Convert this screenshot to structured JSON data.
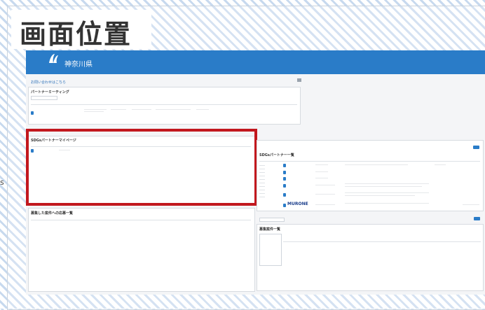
{
  "overlay": {
    "label": "画面位置"
  },
  "header": {
    "title": "神奈川県"
  },
  "contact": {
    "link_text": "お問い合わせはこちら"
  },
  "partner_meeting": {
    "title": "パートナーミーティング",
    "filter_placeholder": "",
    "columns": [
      "",
      "",
      "",
      "",
      "",
      "",
      ""
    ]
  },
  "sdgs_mypage": {
    "title": "SDGsパートナーマイページ",
    "columns": [
      "",
      "",
      "",
      "",
      "",
      "",
      "",
      ""
    ]
  },
  "applications": {
    "title": "募集した案件への応募一覧",
    "columns": [
      "",
      "",
      "",
      "",
      ""
    ]
  },
  "partner_list": {
    "title": "SDGsパートナー一覧",
    "columns": [
      "",
      "",
      "",
      "",
      "",
      "",
      ""
    ],
    "logo_text": "MURONE"
  },
  "project_list": {
    "title": "募集案件一覧",
    "columns": [
      "",
      "",
      "",
      "",
      "",
      ""
    ]
  },
  "side_fragment": {
    "text": "s"
  },
  "colors": {
    "header": "#2a7cc8",
    "highlight": "#c2181e"
  }
}
